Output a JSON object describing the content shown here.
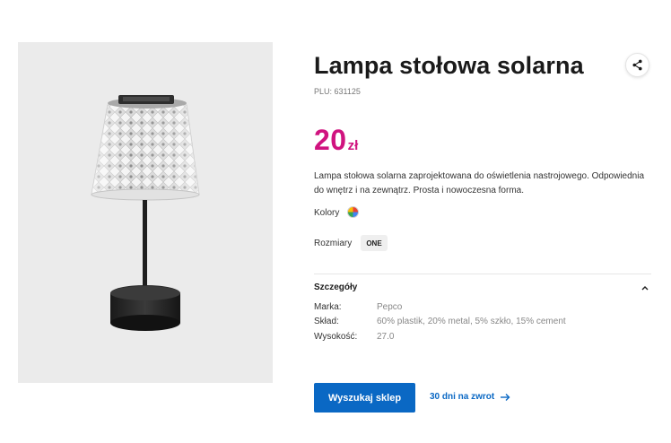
{
  "product": {
    "image_alt": "Lampa stołowa solarna",
    "title": "Lampa stołowa solarna",
    "plu_label": "PLU:",
    "plu_value": "631125",
    "price_amount": "20",
    "price_currency": "zł",
    "price_color": "#d0137f",
    "description": "Lampa stołowa solarna zaprojektowana do oświetlenia nastrojowego. Odpowiednia do wnętrz i na zewnątrz. Prosta i nowoczesna forma."
  },
  "options": {
    "colors_label": "Kolory",
    "color_swatch_icon": "multicolor-swatch",
    "sizes_label": "Rozmiary",
    "size_value": "ONE"
  },
  "details": {
    "title": "Szczegóły",
    "expanded": true,
    "rows": [
      {
        "label": "Marka:",
        "value": "Pepco"
      },
      {
        "label": "Skład:",
        "value": "60% plastik, 20% metal, 5% szkło, 15% cement"
      },
      {
        "label": "Wysokość:",
        "value": "27.0"
      }
    ]
  },
  "actions": {
    "primary_button": "Wyszukaj sklep",
    "primary_color": "#0a68c4",
    "returns_link": "30 dni na zwrot",
    "share_icon": "share-icon"
  }
}
